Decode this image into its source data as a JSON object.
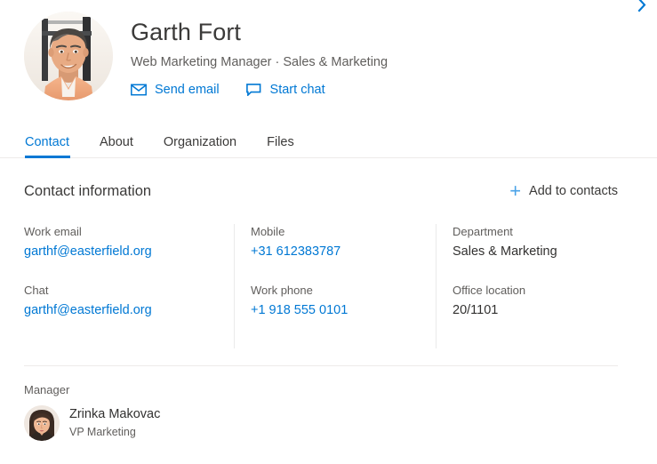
{
  "header": {
    "expand_icon": "chevron-right-icon",
    "accent_color": "#0078d4",
    "person": {
      "name": "Garth Fort",
      "subtitle": "Web Marketing Manager  ·  Sales & Marketing",
      "avatar_alt": "Garth Fort photo"
    },
    "actions": [
      {
        "label": "Send email",
        "icon": "mail-icon"
      },
      {
        "label": "Start chat",
        "icon": "chat-icon"
      }
    ]
  },
  "tabs": [
    {
      "label": "Contact",
      "active": true
    },
    {
      "label": "About",
      "active": false
    },
    {
      "label": "Organization",
      "active": false
    },
    {
      "label": "Files",
      "active": false
    }
  ],
  "contact_section": {
    "title": "Contact information",
    "add_to_contacts": {
      "label": "Add to contacts",
      "icon": "plus-icon",
      "icon_color": "#4aa3e8"
    },
    "columns": [
      {
        "fields": [
          {
            "label": "Work email",
            "value": "garthf@easterfield.org",
            "is_link": true
          },
          {
            "label": "Chat",
            "value": "garthf@easterfield.org",
            "is_link": true
          }
        ]
      },
      {
        "fields": [
          {
            "label": "Mobile",
            "value": "+31 612383787",
            "is_link": true
          },
          {
            "label": "Work phone",
            "value": "+1 918 555 0101",
            "is_link": true
          }
        ]
      },
      {
        "fields": [
          {
            "label": "Department",
            "value": "Sales & Marketing",
            "is_link": false
          },
          {
            "label": "Office location",
            "value": "20/1101",
            "is_link": false
          }
        ]
      }
    ]
  },
  "manager_section": {
    "label": "Manager",
    "person": {
      "name": "Zrinka Makovac",
      "role": "VP Marketing",
      "avatar_alt": "Zrinka Makovac photo"
    }
  }
}
